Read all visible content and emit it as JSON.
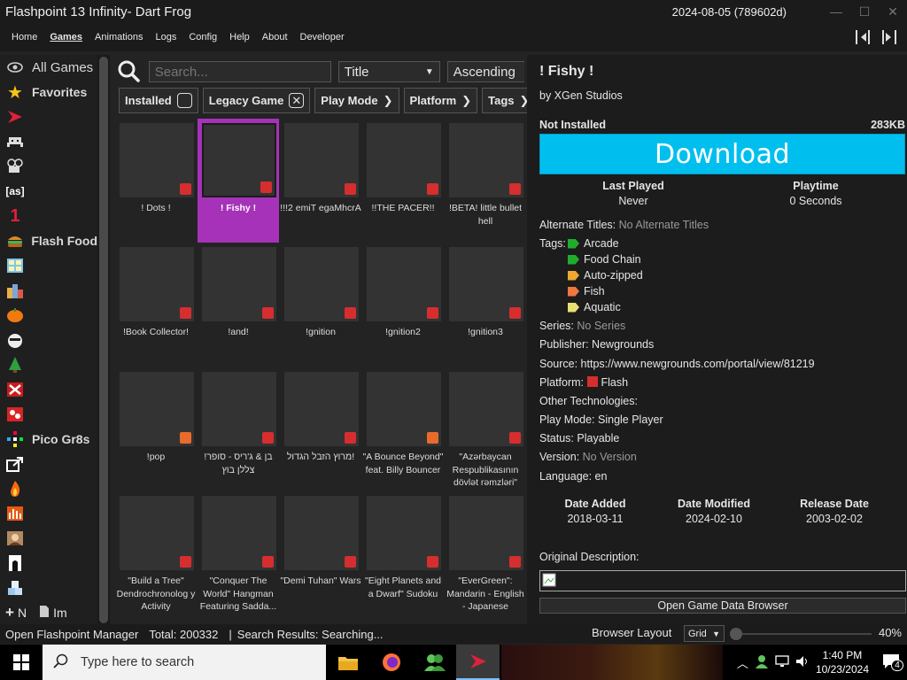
{
  "window": {
    "title": "Flashpoint 13 Infinity- Dart Frog",
    "version": "2024-08-05 (789602d)"
  },
  "menu": [
    "Home",
    "Games",
    "Animations",
    "Logs",
    "Config",
    "Help",
    "About",
    "Developer"
  ],
  "menu_active": "Games",
  "sidebar": {
    "items": [
      {
        "label": "All Games",
        "icon": "eye-icon"
      },
      {
        "label": "Favorites",
        "icon": "star-icon"
      },
      {
        "label": "",
        "icon": "flashpoint-logo-icon"
      },
      {
        "label": "",
        "icon": "space-invader-icon"
      },
      {
        "label": "",
        "icon": "camera-icon"
      },
      {
        "label": "[as]",
        "icon": "actionscript-icon"
      },
      {
        "label": "1",
        "icon": "number-one-icon"
      },
      {
        "label": "Flash Food",
        "icon": "burger-icon"
      },
      {
        "label": "",
        "icon": "window-grid-icon"
      },
      {
        "label": "",
        "icon": "city-icon"
      },
      {
        "label": "",
        "icon": "pumpkin-icon"
      },
      {
        "label": "",
        "icon": "cat-face-icon"
      },
      {
        "label": "",
        "icon": "christmas-tree-icon"
      },
      {
        "label": "",
        "icon": "crossed-icon"
      },
      {
        "label": "",
        "icon": "pattern-icon"
      },
      {
        "label": "Pico Gr8s",
        "icon": "pixel-icon"
      },
      {
        "label": "",
        "icon": "share-icon"
      },
      {
        "label": "",
        "icon": "fire-icon"
      },
      {
        "label": "",
        "icon": "audio-bars-icon"
      },
      {
        "label": "",
        "icon": "portrait-icon"
      },
      {
        "label": "",
        "icon": "arch-icon"
      },
      {
        "label": "",
        "icon": "cubes-icon"
      }
    ],
    "bottom": {
      "new_label": "N",
      "import_label": "Im"
    }
  },
  "search": {
    "placeholder": "Search...",
    "order_by": "Title",
    "order_dir": "Ascending"
  },
  "filters": {
    "installed": "Installed",
    "legacy": "Legacy Game",
    "play_mode": "Play Mode",
    "platform": "Platform",
    "tags": "Tags"
  },
  "games": [
    {
      "title": "! Dots !",
      "badge": "flash"
    },
    {
      "title": "! Fishy !",
      "badge": "flash",
      "selected": true
    },
    {
      "title": "!!!2 emiT egaMhcrA",
      "badge": "flash"
    },
    {
      "title": "!!THE PACER!!",
      "badge": "flash"
    },
    {
      "title": "!BETA! little bullet hell",
      "badge": "flash"
    },
    {
      "title": "!Book Collector!",
      "badge": "flash"
    },
    {
      "title": "!and!",
      "badge": "flash"
    },
    {
      "title": "!gnition",
      "badge": "flash"
    },
    {
      "title": "!gnition2",
      "badge": "flash"
    },
    {
      "title": "!gnition3",
      "badge": "flash"
    },
    {
      "title": "!pop",
      "badge": "html5"
    },
    {
      "title": "בן & ג'ריס - סופר! צללן בוץ",
      "badge": "flash"
    },
    {
      "title": "מרוץ הזבל הגדול!",
      "badge": "flash"
    },
    {
      "title": "\"A Bounce Beyond\" feat. Billy Bouncer",
      "badge": "html5"
    },
    {
      "title": "\"Azərbaycan Respublikasının dövlət rəmzləri\"",
      "badge": "flash"
    },
    {
      "title": "\"Build a Tree\" Dendrochronolog y Activity",
      "badge": "flash"
    },
    {
      "title": "\"Conquer The World\" Hangman Featuring Sadda...",
      "badge": "flash"
    },
    {
      "title": "\"Demi Tuhan\" Wars",
      "badge": "flash"
    },
    {
      "title": "\"Eight Planets and a Dwarf\" Sudoku",
      "badge": "flash"
    },
    {
      "title": "\"EverGreen\": Mandarin - English - Japanese",
      "badge": "flash"
    }
  ],
  "details": {
    "title": "! Fishy !",
    "developer": "by XGen Studios",
    "install_status": "Not Installed",
    "size": "283KB",
    "download_label": "Download",
    "last_played_label": "Last Played",
    "last_played": "Never",
    "playtime_label": "Playtime",
    "playtime": "0 Seconds",
    "alt_titles_label": "Alternate Titles:",
    "alt_titles": "No Alternate Titles",
    "tags_label": "Tags:",
    "tags": [
      {
        "name": "Arcade",
        "color": "#1fae2c"
      },
      {
        "name": "Food Chain",
        "color": "#1fae2c"
      },
      {
        "name": "Auto-zipped",
        "color": "#f0a830"
      },
      {
        "name": "Fish",
        "color": "#f07840"
      },
      {
        "name": "Aquatic",
        "color": "#e8e070"
      }
    ],
    "series_label": "Series:",
    "series": "No Series",
    "publisher": "Publisher: Newgrounds",
    "source": "Source: https://www.newgrounds.com/portal/view/81219",
    "platform_label": "Platform:",
    "platform": "Flash",
    "other_tech": "Other Technologies:",
    "play_mode": "Play Mode: Single Player",
    "status": "Status: Playable",
    "version_label": "Version:",
    "version": "No Version",
    "language": "Language: en",
    "date_added_label": "Date Added",
    "date_added": "2018-03-11",
    "date_modified_label": "Date Modified",
    "date_modified": "2024-02-10",
    "release_date_label": "Release Date",
    "release_date": "2003-02-02",
    "orig_desc_label": "Original Description:",
    "browser_button": "Open Game Data Browser"
  },
  "statusbar": {
    "manager": "Open Flashpoint Manager",
    "total": "Total: 200332",
    "sep": "|",
    "search_results": "Search Results: Searching...",
    "layout_label": "Browser Layout",
    "layout_value": "Grid",
    "zoom": "40%"
  },
  "taskbar": {
    "search_placeholder": "Type here to search",
    "time": "1:40 PM",
    "date": "10/23/2024",
    "notifications": "4"
  }
}
